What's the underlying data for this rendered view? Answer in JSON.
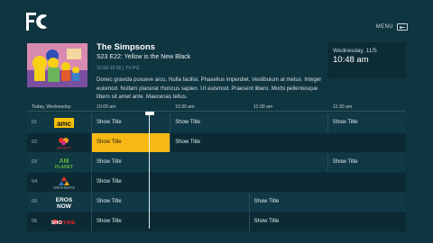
{
  "header": {
    "menu_label": "MENU",
    "icons": {
      "logo": "fc-logo",
      "menu": "back-arrow-icon"
    }
  },
  "featured": {
    "show_name": "The Simpsons",
    "episode": "S23 E22: Yellow is the New Black",
    "meta": "10:00-10:30 | TV-PG",
    "description": "Donec gravida posuere arcu. Nulla facilisi. Phasellus imperdiet. Vestibulum at metus. Integer euismod. Nullam placerat rhoncus sapien. Ut euismod. Praesent libero. Morbi pellentesque libero sit amet ante. Maecenas tellus."
  },
  "clock": {
    "date": "Wednesday, 11/5",
    "time": "10:48 am"
  },
  "timebar": {
    "today": "Today, Wednesday",
    "slots": [
      "10:00 am",
      "10:30 am",
      "11:00 am",
      "11:30 am"
    ]
  },
  "channels": [
    {
      "number": "01",
      "logo": "amc-logo",
      "logo_text": "amc",
      "programs": [
        {
          "title": "Show Title",
          "span": 1,
          "selected": false
        },
        {
          "title": "Show Title",
          "span": 2,
          "selected": false
        },
        {
          "title": "Show Title",
          "span": 1,
          "selected": false
        }
      ]
    },
    {
      "number": "02",
      "logo": "activity-tv-logo",
      "logo_text": "ActivityTV",
      "programs": [
        {
          "title": "Show Title",
          "span": 1,
          "selected": true
        },
        {
          "title": "Show Title",
          "span": 3,
          "selected": false
        }
      ]
    },
    {
      "number": "03",
      "logo": "animal-planet-logo",
      "logo_text": "ANIMAL PLANET",
      "programs": [
        {
          "title": "Show Title",
          "span": 3,
          "selected": false
        },
        {
          "title": "Show Title",
          "span": 1,
          "selected": false
        }
      ]
    },
    {
      "number": "04",
      "logo": "antena-america-logo",
      "logo_text": "antena america",
      "programs": [
        {
          "title": "Show Title",
          "span": 4,
          "selected": false
        }
      ]
    },
    {
      "number": "05",
      "logo": "eros-now-logo",
      "logo_text": "EROS NOW",
      "programs": [
        {
          "title": "Show Title",
          "span": 2,
          "selected": false
        },
        {
          "title": "Show Title",
          "span": 2,
          "selected": false
        }
      ]
    },
    {
      "number": "06",
      "logo": "showtime-logo",
      "logo_text": "SHOWTIME",
      "programs": [
        {
          "title": "Show Title",
          "span": 2,
          "selected": false
        },
        {
          "title": "Show Title",
          "span": 2,
          "selected": false
        }
      ]
    }
  ],
  "colors": {
    "background": "#0f3540",
    "selected": "#f7b814",
    "row_alt": "#0b2a33"
  }
}
